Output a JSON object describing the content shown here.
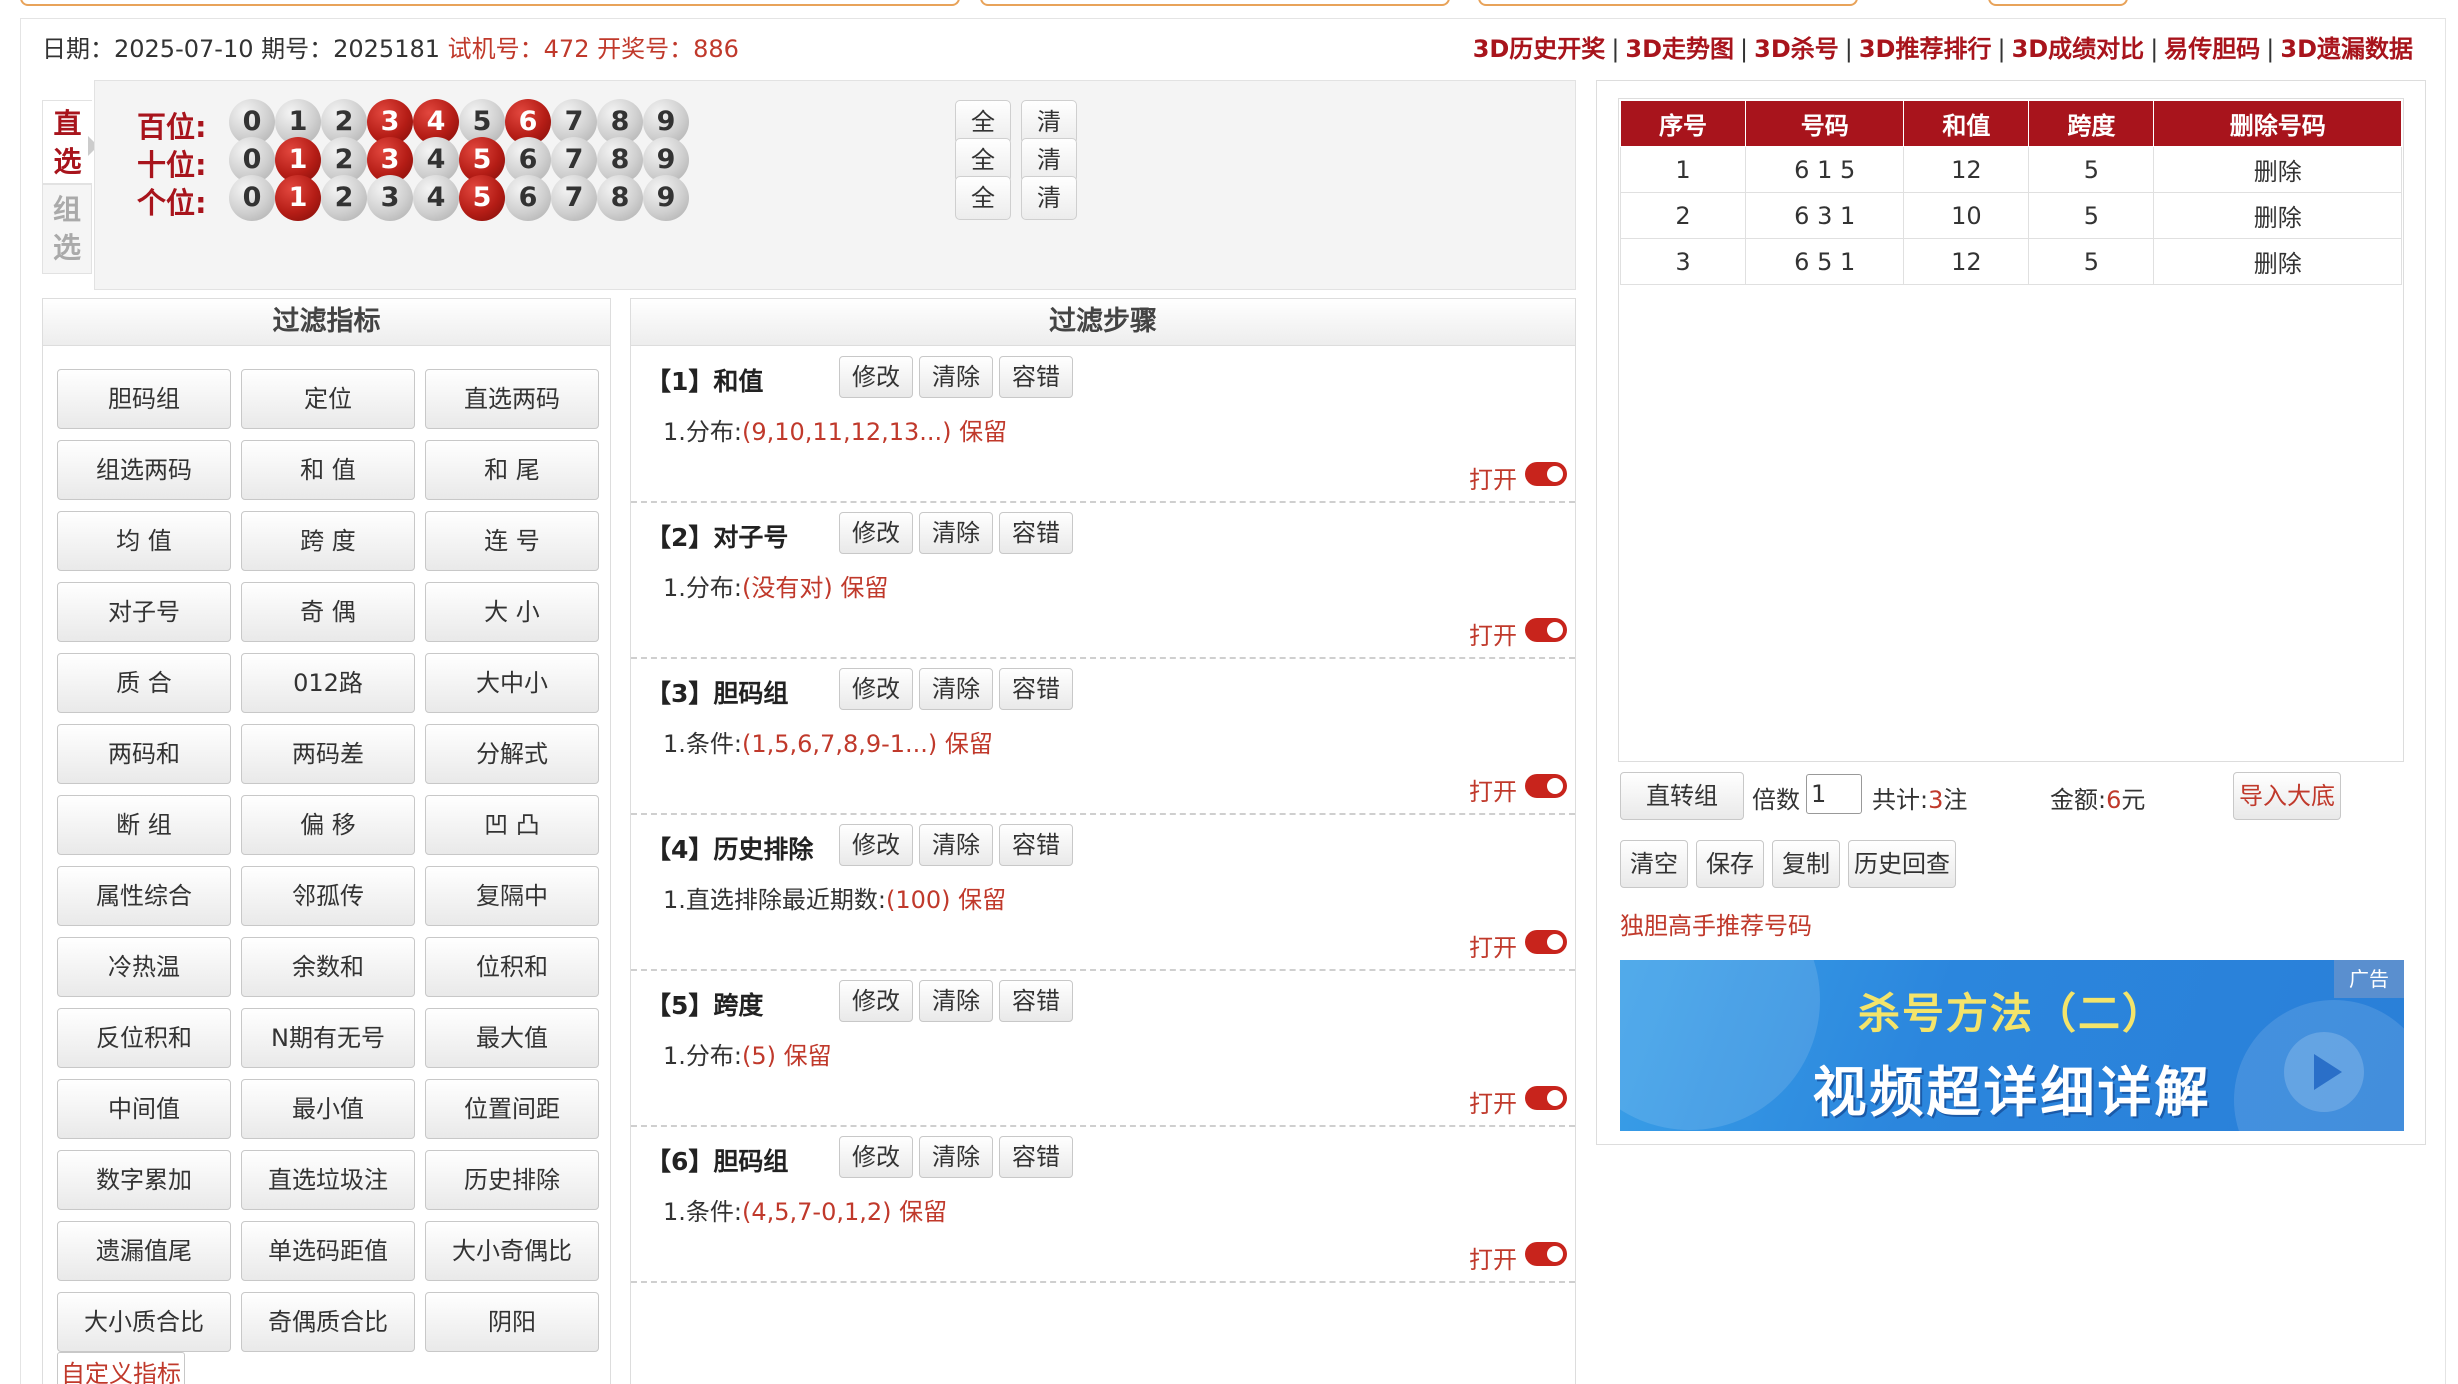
{
  "header": {
    "date_label": "日期：",
    "date": "2025-07-10",
    "period_label": "期号：",
    "period": "2025181",
    "trial_label": "试机号：",
    "trial": "472",
    "draw_label": "开奖号：",
    "draw": "886"
  },
  "nav_links": [
    "3D历史开奖",
    "3D走势图",
    "3D杀号",
    "3D推荐排行",
    "3D成绩对比",
    "易传胆码",
    "3D遗漏数据"
  ],
  "nav_separator": "|",
  "mode_tabs": [
    {
      "label": "直选",
      "active": true
    },
    {
      "label": "组选",
      "active": false
    }
  ],
  "picker": {
    "rows": [
      {
        "label": "百位:",
        "selected": [
          3,
          4,
          6
        ]
      },
      {
        "label": "十位:",
        "selected": [
          1,
          3,
          5
        ]
      },
      {
        "label": "个位:",
        "selected": [
          1,
          5
        ]
      }
    ],
    "digits": [
      "0",
      "1",
      "2",
      "3",
      "4",
      "5",
      "6",
      "7",
      "8",
      "9"
    ],
    "all_label": "全",
    "clear_label": "清"
  },
  "filter_indicators": {
    "title": "过滤指标",
    "items": [
      "胆码组",
      "定位",
      "直选两码",
      "组选两码",
      "和 值",
      "和 尾",
      "均 值",
      "跨 度",
      "连 号",
      "对子号",
      "奇 偶",
      "大 小",
      "质 合",
      "012路",
      "大中小",
      "两码和",
      "两码差",
      "分解式",
      "断 组",
      "偏 移",
      "凹 凸",
      "属性综合",
      "邻孤传",
      "复隔中",
      "冷热温",
      "余数和",
      "位积和",
      "反位积和",
      "N期有无号",
      "最大值",
      "中间值",
      "最小值",
      "位置间距",
      "数字累加",
      "直选垃圾注",
      "历史排除",
      "遗漏值尾",
      "单选码距值",
      "大小奇偶比",
      "大小质合比",
      "奇偶质合比",
      "阴阳"
    ],
    "custom_label": "自定义指标"
  },
  "filter_steps": {
    "title": "过滤步骤",
    "edit_label": "修改",
    "clear_label": "清除",
    "tolerance_label": "容错",
    "open_label": "打开",
    "keep_label": "保留",
    "steps": [
      {
        "title": "【1】和值",
        "cond_prefix": "1.分布:",
        "value": "(9,10,11,12,13...)",
        "enabled": true
      },
      {
        "title": "【2】对子号",
        "cond_prefix": "1.分布:",
        "value": "(没有对)",
        "enabled": true
      },
      {
        "title": "【3】胆码组",
        "cond_prefix": "1.条件:",
        "value": "(1,5,6,7,8,9-1...)",
        "enabled": true
      },
      {
        "title": "【4】历史排除",
        "cond_prefix": "1.直选排除最近期数:",
        "value": "(100)",
        "enabled": true
      },
      {
        "title": "【5】跨度",
        "cond_prefix": "1.分布:",
        "value": "(5)",
        "enabled": true
      },
      {
        "title": "【6】胆码组",
        "cond_prefix": "1.条件:",
        "value": "(4,5,7-0,1,2)",
        "enabled": true
      }
    ]
  },
  "result_table": {
    "headers": [
      "序号",
      "号码",
      "和值",
      "跨度",
      "删除号码"
    ],
    "rows": [
      [
        "1",
        "6 1 5",
        "12",
        "5",
        "删除"
      ],
      [
        "2",
        "6 3 1",
        "10",
        "5",
        "删除"
      ],
      [
        "3",
        "6 5 1",
        "12",
        "5",
        "删除"
      ]
    ]
  },
  "controls": {
    "convert_label": "直转组",
    "multiplier_label": "倍数",
    "multiplier_value": "1",
    "total_label": "共计:",
    "total_value": "3",
    "total_unit": "注",
    "amount_label": "金额:",
    "amount_value": "6",
    "amount_unit": "元",
    "import_label": "导入大底",
    "clear_label": "清空",
    "save_label": "保存",
    "copy_label": "复制",
    "history_label": "历史回查",
    "recommend_link": "独胆高手推荐号码"
  },
  "ad": {
    "line1": "杀号方法（二）",
    "line2": "视频超详细详解",
    "tag": "广告",
    "bg_color": "#2b86dd",
    "accent_color": "#f4e46a"
  },
  "colors": {
    "brand_red": "#a8141c",
    "text_red": "#c0392b"
  }
}
